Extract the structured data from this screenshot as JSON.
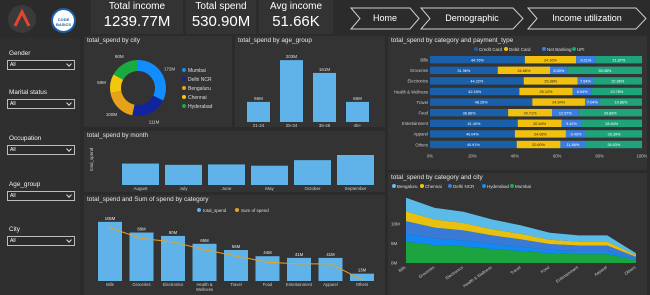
{
  "kpis": [
    {
      "label": "Total income",
      "value": "1239.77M"
    },
    {
      "label": "Total spend",
      "value": "530.90M"
    },
    {
      "label": "Avg income",
      "value": "51.66K"
    }
  ],
  "nav": {
    "items": [
      "Home",
      "Demographic",
      "Income utilization"
    ]
  },
  "logo": {
    "text": "CODE BASICS"
  },
  "slicers": [
    {
      "label": "Gender",
      "value": "All"
    },
    {
      "label": "Marital status",
      "value": "All"
    },
    {
      "label": "Occupation",
      "value": "All"
    },
    {
      "label": "Age_group",
      "value": "All"
    },
    {
      "label": "City",
      "value": "All"
    }
  ],
  "colors": {
    "navy": "#12239e",
    "teal": "#118dff",
    "blue": "#5fb3e8",
    "orange": "#e8a21a",
    "cc": "#1a5faa",
    "debit": "#f2c10f",
    "netbank": "#3a7ee0",
    "upi": "#1fa37a",
    "light": "#5ec3f2",
    "yellow": "#f2c80f",
    "green": "#1aab40"
  },
  "charts": {
    "city": {
      "title": "total_spend by city",
      "legend": [
        "Mumbai",
        "Delhi NCR",
        "Bengaluru",
        "Chennai",
        "Hyderabad"
      ],
      "labels": [
        "172M",
        "111M",
        "100M",
        "58M",
        "90M"
      ]
    },
    "age": {
      "title": "total_spend by age_group",
      "labels": [
        "66M",
        "203M",
        "161M",
        "66M"
      ]
    },
    "month": {
      "title": "total_spend by month",
      "ylabel": "total_spend"
    },
    "cat": {
      "title": "total_spend and Sum of spend by category",
      "legend": [
        "total_spend",
        "Sum of spend"
      ],
      "labels": [
        "105M",
        "86M",
        "80M",
        "66M",
        "55M",
        "44M",
        "41M",
        "41M",
        "13M"
      ]
    },
    "pay": {
      "title": "total_spend by category and payment_type",
      "legend": [
        "Credit Card",
        "Debit Card",
        "Net Banking",
        "UPI"
      ],
      "axis": [
        "0%",
        "20%",
        "40%",
        "60%",
        "80%",
        "100%"
      ]
    },
    "area": {
      "title": "total_spend by category and city",
      "legend": [
        "Bengaluru",
        "Chennai",
        "Delhi NCR",
        "Hyderabad",
        "Mumbai"
      ],
      "yticks": [
        "10M",
        "5M",
        "0M"
      ]
    }
  },
  "chart_data": [
    {
      "type": "pie",
      "title": "total_spend by city",
      "categories": [
        "Mumbai",
        "Delhi NCR",
        "Bengaluru",
        "Chennai",
        "Hyderabad"
      ],
      "values": [
        172,
        111,
        100,
        58,
        90
      ]
    },
    {
      "type": "bar",
      "title": "total_spend by age_group",
      "categories": [
        "21-24",
        "25-34",
        "35-45",
        "45+"
      ],
      "values": [
        66,
        203,
        161,
        66
      ]
    },
    {
      "type": "bar",
      "title": "total_spend by month",
      "categories": [
        "August",
        "July",
        "June",
        "May",
        "October",
        "September"
      ],
      "values": [
        50,
        47,
        48,
        45,
        58,
        70
      ],
      "ylabel": "total_spend"
    },
    {
      "type": "bar",
      "title": "total_spend and Sum of spend by category",
      "categories": [
        "Bills",
        "Groceries",
        "Electronics",
        "Health & Wellness",
        "Travel",
        "Food",
        "Entertainment",
        "Apparel",
        "Others"
      ],
      "series": [
        {
          "name": "total_spend",
          "values": [
            105,
            86,
            80,
            66,
            55,
            44,
            41,
            41,
            13
          ]
        },
        {
          "name": "Sum of spend",
          "values": [
            105,
            86,
            80,
            66,
            55,
            44,
            41,
            41,
            13
          ]
        }
      ]
    },
    {
      "type": "bar",
      "title": "total_spend by category and payment_type",
      "categories": [
        "Bills",
        "Groceries",
        "Electronics",
        "Health & Wellness",
        "Travel",
        "Food",
        "Entertainment",
        "Apparel",
        "Others"
      ],
      "series": [
        {
          "name": "Credit Card",
          "values": [
            44.76,
            31.96,
            44.22,
            42.16,
            48.26,
            36.86,
            41.4,
            40.04,
            40.91
          ]
        },
        {
          "name": "Debit Card",
          "values": [
            24.16,
            24.66,
            25.38,
            25.12,
            24.84,
            20.71,
            20.64,
            24.08,
            20.6
          ]
        },
        {
          "name": "Net Banking",
          "values": [
            9.21,
            8.3,
            7.54,
            8.94,
            7.04,
            12.57,
            9.42,
            9.49,
            11.86
          ]
        },
        {
          "name": "UPI",
          "values": [
            21.87,
            35.08,
            22.86,
            23.78,
            19.86,
            29.86,
            28.54,
            26.39,
            26.63
          ]
        }
      ],
      "xlim": [
        0,
        100
      ]
    },
    {
      "type": "area",
      "title": "total_spend by category and city",
      "categories": [
        "Bills",
        "Groceries",
        "Electronics",
        "Health & Wellness",
        "Travel",
        "Food",
        "Entertainment",
        "Apparel",
        "Others"
      ],
      "series": [
        {
          "name": "Bengaluru",
          "values": [
            3.5,
            3.0,
            2.9,
            2.5,
            2.2,
            1.8,
            1.6,
            1.6,
            0.5
          ]
        },
        {
          "name": "Chennai",
          "values": [
            2.5,
            2.1,
            1.9,
            1.6,
            1.4,
            1.1,
            1.0,
            1.0,
            0.4
          ]
        },
        {
          "name": "Delhi NCR",
          "values": [
            3.3,
            2.8,
            2.6,
            2.2,
            1.9,
            1.5,
            1.4,
            1.4,
            0.5
          ]
        },
        {
          "name": "Hyderabad",
          "values": [
            2.0,
            1.7,
            1.5,
            1.3,
            1.1,
            0.9,
            0.8,
            0.8,
            0.3
          ]
        },
        {
          "name": "Mumbai",
          "values": [
            5.5,
            4.6,
            4.3,
            3.6,
            3.1,
            2.5,
            2.3,
            2.3,
            0.8
          ]
        }
      ],
      "yticks": [
        "10M",
        "5M",
        "0M"
      ]
    }
  ]
}
